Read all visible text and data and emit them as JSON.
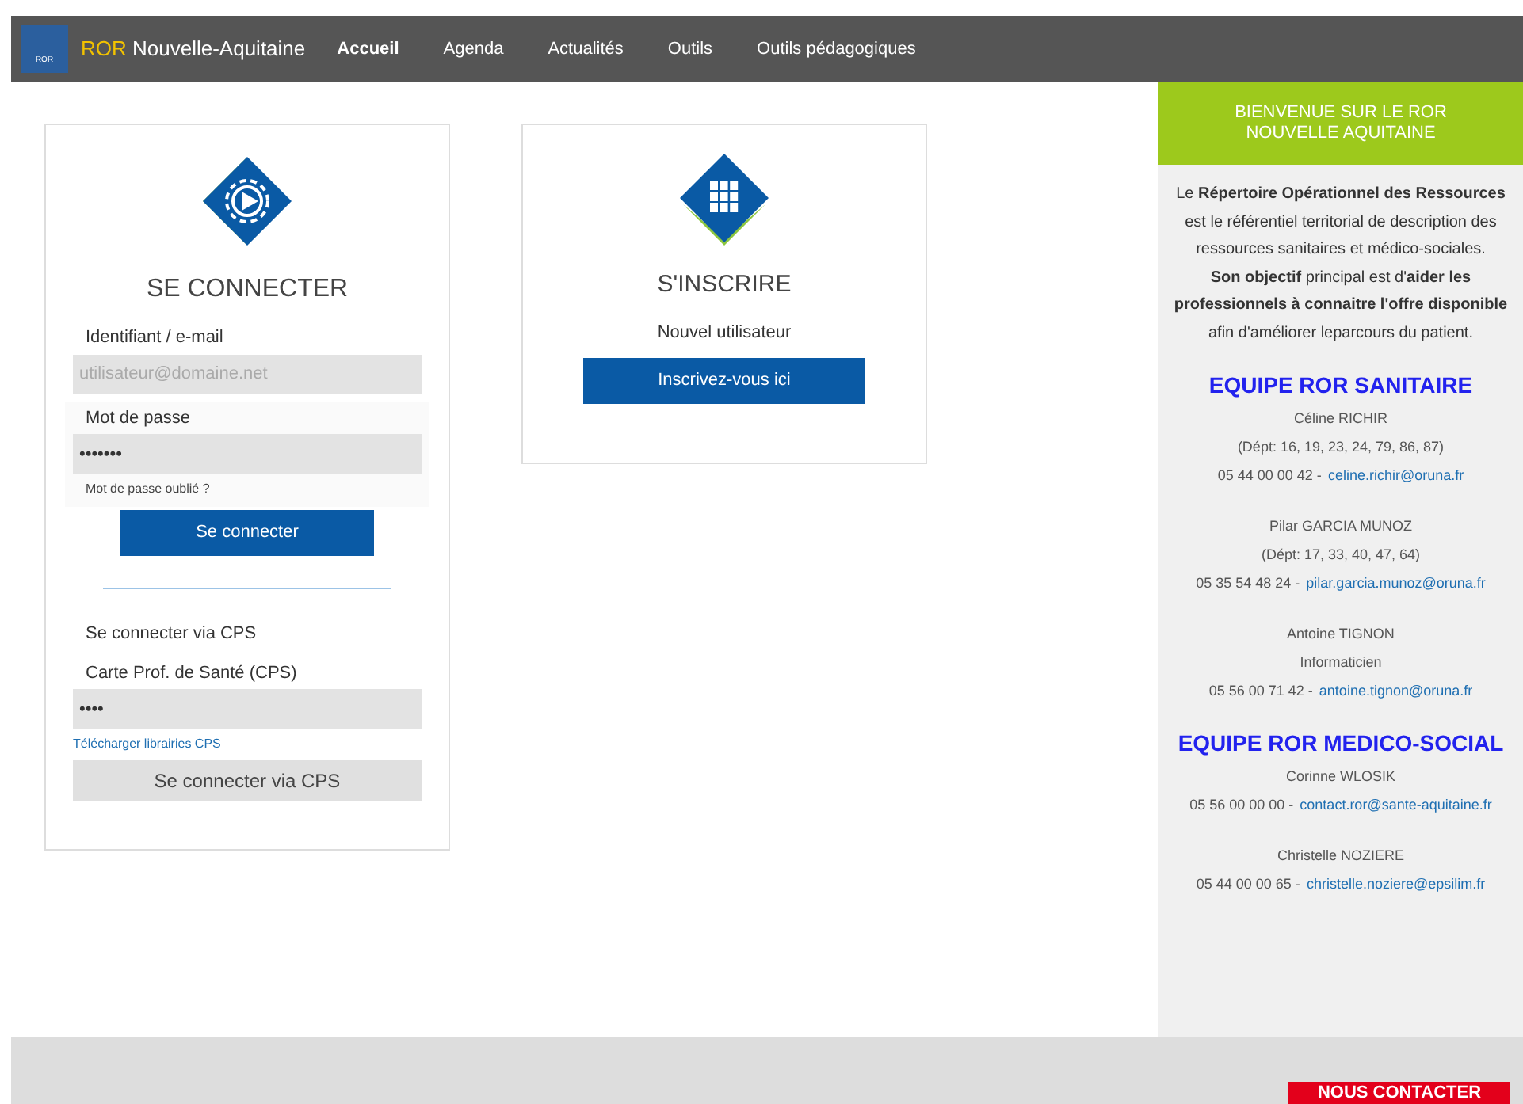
{
  "header": {
    "logo_letters": "ROR",
    "brand_accent": "ROR",
    "brand_rest": "Nouvelle-Aquitaine"
  },
  "nav": [
    {
      "label": "Accueil",
      "selected": true
    },
    {
      "label": "Agenda",
      "selected": false
    },
    {
      "label": "Actualités",
      "selected": false
    },
    {
      "label": "Outils",
      "selected": false
    },
    {
      "label": "Outils pédagogiques",
      "selected": false
    }
  ],
  "login": {
    "title": "SE CONNECTER",
    "id_label": "Identifiant / e-mail",
    "id_placeholder": "utilisateur@domaine.net",
    "password_label": "Mot de passe",
    "password_value": "•••••••",
    "forgot_link": "Mot de passe oublié ?",
    "submit": "Se connecter",
    "cps_heading": "Se connecter via CPS",
    "cps_label": "Carte Prof. de Santé (CPS)",
    "cps_value": "••••",
    "cps_download": "Télécharger librairies CPS",
    "cps_submit": "Se connecter via CPS"
  },
  "register": {
    "title": "S'INSCRIRE",
    "subtitle": "Nouvel utilisateur",
    "button": "Inscrivez-vous ici"
  },
  "sidebar": {
    "title": "BIENVENUE SUR LE ROR NOUVELLE AQUITAINE",
    "paragraphs": [
      "Le **Répertoire Opérationnel des Ressources**",
      "est le référentiel territorial de description des ressources sanitaires et médico-sociales.",
      "**Son objectif** principal est d'**aider les professionnels à connaitre l'offre disponible**",
      "afin d'améliorer leparcours du patient."
    ],
    "teams": [
      {
        "title": "EQUIPE ROR SANITAIRE",
        "people": [
          {
            "name": "Céline RICHIR",
            "detail": "(Dépt: 16, 19, 23, 24, 79, 86, 87)",
            "phone": "05 44 00 00 42 -",
            "email": "celine.richir@oruna.fr"
          },
          {
            "name": "Pilar GARCIA MUNOZ",
            "detail": "(Dépt: 17, 33, 40, 47, 64)",
            "phone": "05 35 54 48 24 -",
            "email": "pilar.garcia.munoz@oruna.fr"
          },
          {
            "name": "Antoine TIGNON",
            "detail": "Informaticien",
            "phone": "05 56 00 71 42 -",
            "email": "antoine.tignon@oruna.fr"
          }
        ]
      },
      {
        "title": "EQUIPE ROR MEDICO-SOCIAL",
        "people": [
          {
            "name": "Corinne WLOSIK",
            "phone": "05 56 00 00 00 -",
            "email": "contact.ror@sante-aquitaine.fr"
          },
          {
            "name": "Christelle NOZIERE",
            "phone": "05 44 00 00 65 -",
            "email": "christelle.noziere@epsilim.fr"
          }
        ]
      }
    ]
  },
  "footer": {
    "contact_button": "NOUS CONTACTER"
  }
}
